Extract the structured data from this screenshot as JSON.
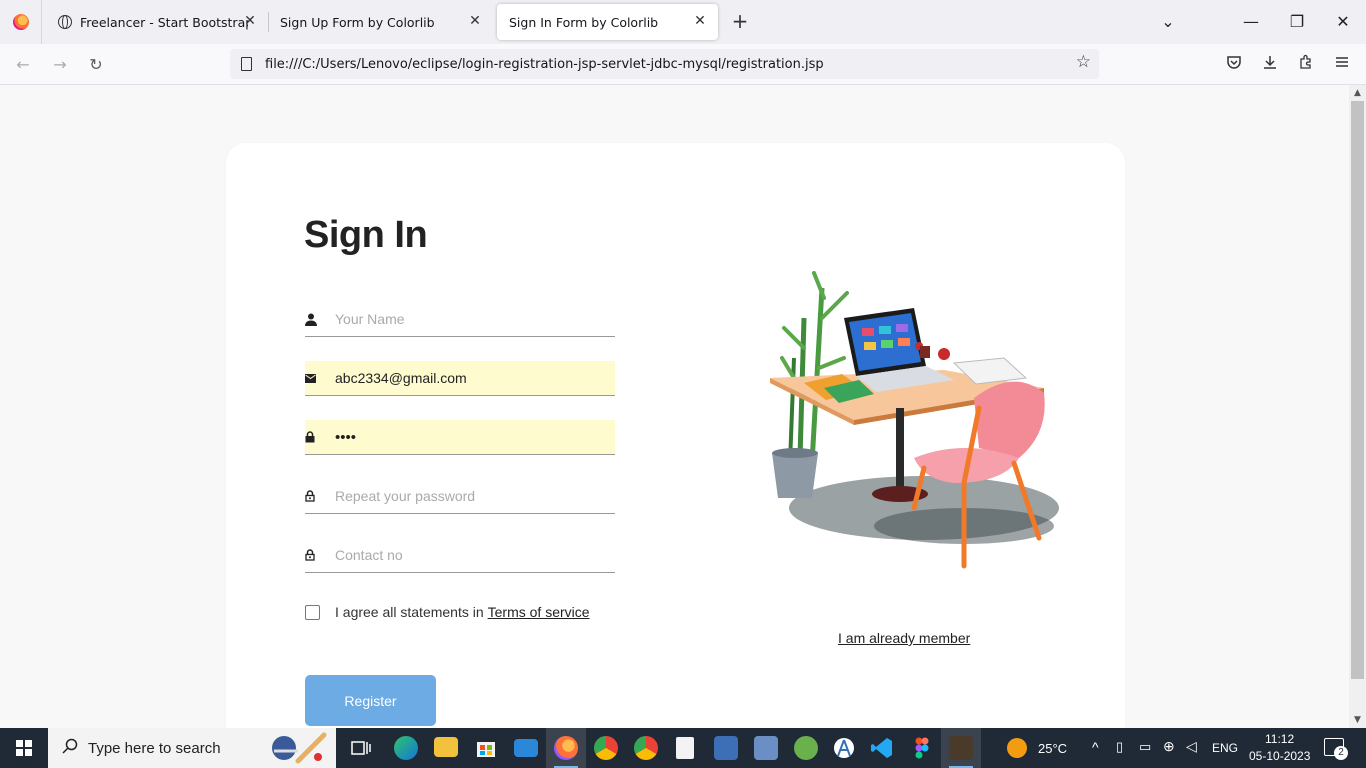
{
  "browser": {
    "tabs": [
      {
        "label": "Freelancer - Start Bootstrap The",
        "close": "✕"
      },
      {
        "label": "Sign Up Form by Colorlib",
        "close": "✕"
      },
      {
        "label": "Sign In Form by Colorlib",
        "close": "✕"
      }
    ],
    "url": "file:///C:/Users/Lenovo/eclipse/login-registration-jsp-servlet-jdbc-mysql/registration.jsp",
    "new_tab": "+"
  },
  "form": {
    "title": "Sign In",
    "name_placeholder": "Your Name",
    "email_value": "abc2334@gmail.com",
    "password_value": "••••",
    "repeat_password_placeholder": "Repeat your password",
    "contact_placeholder": "Contact no",
    "agree_text": "I agree all statements in",
    "terms_link": "Terms of service",
    "register_label": "Register",
    "member_link": "I am already member"
  },
  "taskbar": {
    "search_placeholder": "Type here to search",
    "weather": "25°C",
    "language": "ENG",
    "time": "11:12",
    "date": "05-10-2023",
    "notification_count": "2"
  },
  "colors": {
    "accent": "#6dabe4",
    "autofill": "#fefbce",
    "taskbar": "#1f2a36"
  }
}
